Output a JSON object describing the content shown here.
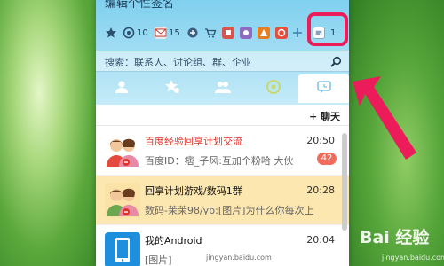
{
  "header": {
    "signature": "编辑个性签名"
  },
  "toolbar": {
    "items": [
      {
        "name": "favorite-icon",
        "count": ""
      },
      {
        "name": "qzone-icon",
        "count": "10"
      },
      {
        "name": "mail-icon",
        "count": "15"
      },
      {
        "name": "game-icon",
        "count": ""
      },
      {
        "name": "shop-icon",
        "count": ""
      },
      {
        "name": "app-icon-1",
        "count": ""
      },
      {
        "name": "app-icon-2",
        "count": ""
      },
      {
        "name": "app-icon-3",
        "count": ""
      },
      {
        "name": "add-icon",
        "count": ""
      }
    ],
    "message_box_count": "1"
  },
  "search": {
    "placeholder": "搜索：联系人、讨论组、群、企业"
  },
  "tabs": [
    {
      "name": "contacts",
      "icon": "person-icon"
    },
    {
      "name": "favorites",
      "icon": "star-person-icon"
    },
    {
      "name": "groups",
      "icon": "group-icon"
    },
    {
      "name": "qzone",
      "icon": "qzone-icon"
    },
    {
      "name": "recent",
      "icon": "chat-icon",
      "active": true
    }
  ],
  "chat_bar": {
    "label": "+ 聊天"
  },
  "conversations": [
    {
      "title": "百度经验回享计划交流",
      "title_color": "#e0322b",
      "time": "20:50",
      "message": "百度ID：痞_子风:互加个粉哈 大伙",
      "badge": "42",
      "selected": false
    },
    {
      "title": "回享计划游戏/数码1群",
      "title_color": "#111111",
      "time": "20:28",
      "message": "数码-茉茉98/yb:[图片]为什么你每次上",
      "badge": "",
      "selected": true
    },
    {
      "title": "我的Android",
      "title_color": "#111111",
      "time": "20:04",
      "message": "[图片]",
      "badge": "",
      "selected": false
    }
  ],
  "watermark": {
    "brand": "Bai 经验",
    "url": "jingyan.baidu.com",
    "url_left": "jingyan.baidu.com"
  },
  "colors": {
    "highlight": "#ec1b5a",
    "header_top": "#7fd0ef",
    "selected_row": "#fde7b0",
    "badge": "#f06c5b"
  }
}
